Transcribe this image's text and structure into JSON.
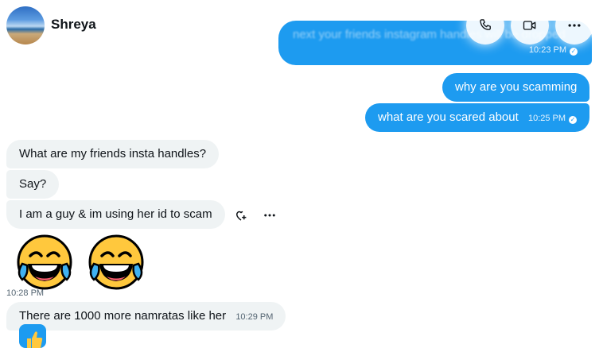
{
  "header": {
    "contact_name": "Shreya",
    "actions": [
      "phone-icon",
      "video-icon",
      "more-icon"
    ]
  },
  "messages_out": [
    {
      "faded_text": "next your friends instagram handles will be dropped",
      "time": "10:23 PM"
    },
    {
      "text": "why are you scamming"
    },
    {
      "text": "what are you scared about",
      "time": "10:25 PM"
    }
  ],
  "messages_in": [
    {
      "text": "What are my friends insta handles?"
    },
    {
      "text": "Say?"
    },
    {
      "text": "I am a guy & im using her id to scam"
    },
    {
      "emoji": [
        "face-with-tears-of-joy",
        "face-with-tears-of-joy"
      ],
      "time": "10:28 PM"
    },
    {
      "text": "There are 1000 more namratas like her",
      "time": "10:29 PM"
    }
  ],
  "colors": {
    "accent": "#1d9bf0",
    "incoming_bg": "#eff3f4",
    "muted": "#536471"
  }
}
